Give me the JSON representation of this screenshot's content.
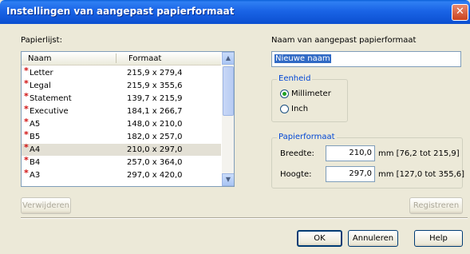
{
  "window": {
    "title": "Instellingen van aangepast papierformaat",
    "close_glyph": "✕"
  },
  "paper_list": {
    "label": "Papierlijst:",
    "columns": {
      "name": "Naam",
      "format": "Formaat"
    },
    "rows": [
      {
        "name": "Letter",
        "format": "215,9 x 279,4"
      },
      {
        "name": "Legal",
        "format": "215,9 x 355,6"
      },
      {
        "name": "Statement",
        "format": "139,7 x 215,9"
      },
      {
        "name": "Executive",
        "format": "184,1 x 266,7"
      },
      {
        "name": "A5",
        "format": "148,0 x 210,0"
      },
      {
        "name": "B5",
        "format": "182,0 x 257,0"
      },
      {
        "name": "A4",
        "format": "210,0 x 297,0"
      },
      {
        "name": "B4",
        "format": "257,0 x 364,0"
      },
      {
        "name": "A3",
        "format": "297,0 x 420,0"
      }
    ],
    "selected_row": "A4",
    "row_marker": "*"
  },
  "custom_name": {
    "label": "Naam van aangepast papierformaat",
    "value": "Nieuwe naam"
  },
  "unit": {
    "group_label": "Eenheid",
    "options": [
      "Millimeter",
      "Inch"
    ],
    "selected": "Millimeter"
  },
  "paper_format": {
    "group_label": "Papierformaat",
    "width": {
      "label": "Breedte:",
      "value": "210,0",
      "range": "mm [76,2 tot 215,9]"
    },
    "height": {
      "label": "Hoogte:",
      "value": "297,0",
      "range": "mm [127,0 tot 355,6]"
    }
  },
  "buttons": {
    "delete": "Verwijderen",
    "register": "Registreren",
    "ok": "OK",
    "cancel": "Annuleren",
    "help": "Help"
  },
  "icons": {
    "scroll_up": "▲",
    "scroll_down": "▼"
  }
}
